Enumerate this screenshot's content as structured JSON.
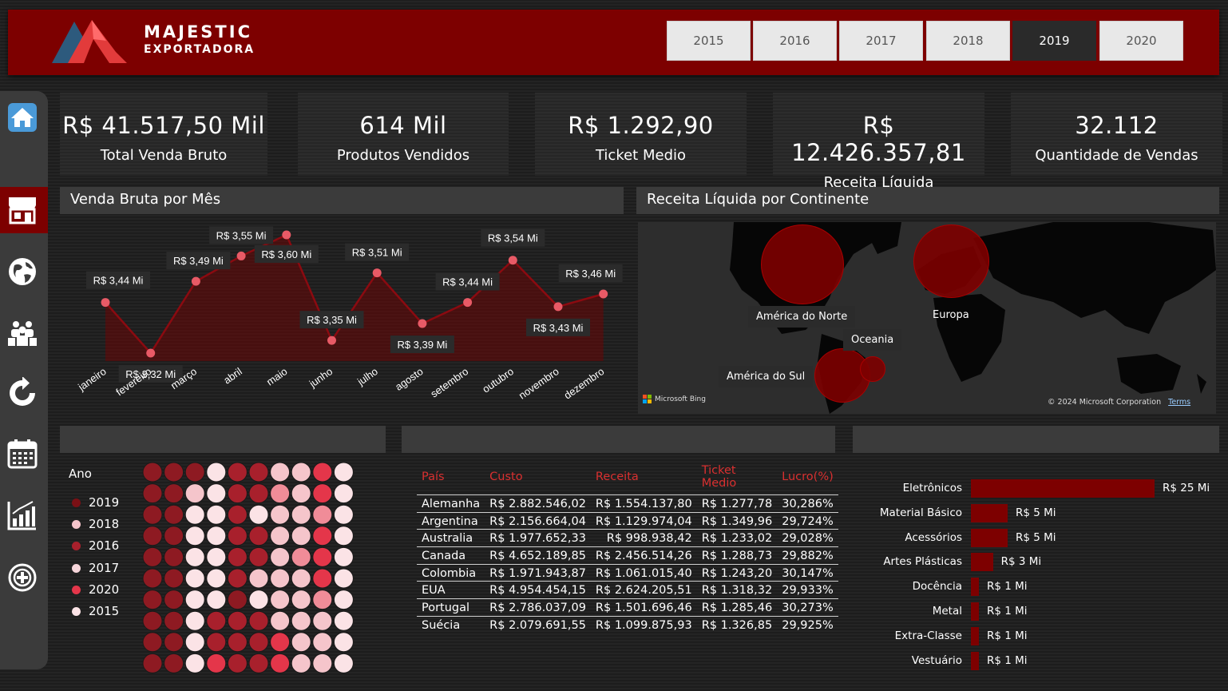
{
  "brand": {
    "line1": "MAJESTIC",
    "line2": "EXPORTADORA"
  },
  "years": [
    {
      "label": "2015",
      "active": false
    },
    {
      "label": "2016",
      "active": false
    },
    {
      "label": "2017",
      "active": false
    },
    {
      "label": "2018",
      "active": false
    },
    {
      "label": "2019",
      "active": true
    },
    {
      "label": "2020",
      "active": false
    }
  ],
  "sidebar": [
    "home-icon",
    "store-icon",
    "globe-icon",
    "team-icon",
    "refresh-icon",
    "calendar-icon",
    "bar-chart-icon",
    "add-circle-icon"
  ],
  "kpis": [
    {
      "value": "R$ 41.517,50 Mil",
      "label": "Total Venda Bruto"
    },
    {
      "value": "614 Mil",
      "label": "Produtos Vendidos"
    },
    {
      "value": "R$ 1.292,90",
      "label": "Ticket Medio"
    },
    {
      "value": "R$ 12.426.357,81",
      "label": "Receita Líquida"
    },
    {
      "value": "32.112",
      "label": "Quantidade de Vendas"
    }
  ],
  "panels": {
    "monthly_title": "Venda Bruta por Mês",
    "map_title": "Receita Líquida por Continente"
  },
  "map": {
    "labels": [
      "América do Norte",
      "Europa",
      "Oceania",
      "América do Sul"
    ],
    "bing": "Microsoft Bing",
    "copyright": "© 2024 Microsoft Corporation",
    "terms": "Terms"
  },
  "legend": {
    "title": "Ano",
    "items": [
      {
        "label": "2019",
        "color": "#7a1015"
      },
      {
        "label": "2018",
        "color": "#f5c5cb"
      },
      {
        "label": "2016",
        "color": "#a8202c"
      },
      {
        "label": "2017",
        "color": "#f7d6db"
      },
      {
        "label": "2020",
        "color": "#e4364a"
      },
      {
        "label": "2015",
        "color": "#fbe3e6"
      }
    ]
  },
  "table": {
    "headers": [
      "País",
      "Custo",
      "Receita",
      "Ticket Medio",
      "Lucro(%)"
    ],
    "rows": [
      [
        "Alemanha",
        "R$ 2.882.546,02",
        "R$ 1.554.137,80",
        "R$ 1.277,78",
        "30,286%"
      ],
      [
        "Argentina",
        "R$ 2.156.664,04",
        "R$ 1.129.974,04",
        "R$ 1.349,96",
        "29,724%"
      ],
      [
        "Australia",
        "R$ 1.977.652,33",
        "R$ 998.938,42",
        "R$ 1.233,02",
        "29,028%"
      ],
      [
        "Canada",
        "R$ 4.652.189,85",
        "R$ 2.456.514,26",
        "R$ 1.288,73",
        "29,882%"
      ],
      [
        "Colombia",
        "R$ 1.971.943,87",
        "R$ 1.061.015,40",
        "R$ 1.243,20",
        "30,147%"
      ],
      [
        "EUA",
        "R$ 4.954.454,15",
        "R$ 2.624.205,51",
        "R$ 1.318,32",
        "29,933%"
      ],
      [
        "Portugal",
        "R$ 2.786.037,09",
        "R$ 1.501.696,46",
        "R$ 1.285,46",
        "30,273%"
      ],
      [
        "Suécia",
        "R$ 2.079.691,55",
        "R$ 1.099.875,93",
        "R$ 1.326,85",
        "29,925%"
      ]
    ]
  },
  "colors": {
    "accent": "#7d0000",
    "point": "#e85a66",
    "line": "#8b0a10"
  },
  "chart_data": [
    {
      "type": "area",
      "title": "Venda Bruta por Mês",
      "categories": [
        "janeiro",
        "fevereiro",
        "março",
        "abril",
        "maio",
        "junho",
        "julho",
        "agosto",
        "setembro",
        "outubro",
        "novembro",
        "dezembro"
      ],
      "values": [
        3.44,
        3.32,
        3.49,
        3.55,
        3.6,
        3.35,
        3.51,
        3.39,
        3.44,
        3.54,
        3.43,
        3.46
      ],
      "data_labels": [
        "R$ 3,44 Mi",
        "R$ 3,32 Mi",
        "R$ 3,49 Mi",
        "R$ 3,55 Mi",
        "R$ 3,60 Mi",
        "R$ 3,35 Mi",
        "R$ 3,51 Mi",
        "R$ 3,39 Mi",
        "R$ 3,44 Mi",
        "R$ 3,54 Mi",
        "R$ 3,43 Mi",
        "R$ 3,46 Mi"
      ],
      "grid": false
    },
    {
      "type": "bar",
      "orientation": "horizontal",
      "categories": [
        "Eletrônicos",
        "Material Básico",
        "Acessórios",
        "Artes Plásticas",
        "Docência",
        "Metal",
        "Extra-Classe",
        "Vestuário"
      ],
      "values": [
        25,
        5,
        5,
        3,
        1,
        1,
        1,
        1
      ],
      "data_labels": [
        "R$ 25 Mi",
        "R$ 5 Mi",
        "R$ 5 Mi",
        "R$ 3 Mi",
        "R$ 1 Mi",
        "R$ 1 Mi",
        "R$ 1 Mi",
        "R$ 1 Mi"
      ]
    }
  ]
}
